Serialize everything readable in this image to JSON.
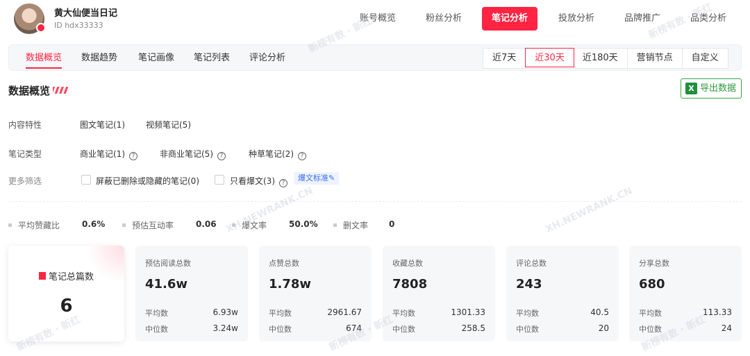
{
  "account": {
    "name": "黄大仙便当日记",
    "id_text": "ID hdx33333"
  },
  "top_nav": [
    {
      "label": "账号概览",
      "active": false
    },
    {
      "label": "粉丝分析",
      "active": false
    },
    {
      "label": "笔记分析",
      "active": true
    },
    {
      "label": "投放分析",
      "active": false
    },
    {
      "label": "品牌推广",
      "active": false
    },
    {
      "label": "品类分析",
      "active": false
    }
  ],
  "sub_tabs": [
    {
      "label": "数据概览",
      "active": true
    },
    {
      "label": "数据趋势",
      "active": false
    },
    {
      "label": "笔记画像",
      "active": false
    },
    {
      "label": "笔记列表",
      "active": false
    },
    {
      "label": "评论分析",
      "active": false
    }
  ],
  "date_ranges": [
    {
      "label": "近7天",
      "active": false
    },
    {
      "label": "近30天",
      "active": true
    },
    {
      "label": "近180天",
      "active": false
    },
    {
      "label": "营销节点",
      "active": false
    },
    {
      "label": "自定义",
      "active": false
    }
  ],
  "section": {
    "title": "数据概览",
    "export_label": "导出数据",
    "excel_glyph": "X"
  },
  "filters": {
    "content_label": "内容特性",
    "content_options": [
      "图文笔记(1)",
      "视频笔记(5)"
    ],
    "type_label": "笔记类型",
    "type_options": [
      "商业笔记(1)",
      "非商业笔记(5)",
      "种草笔记(2)"
    ],
    "more_label": "更多筛选",
    "hide_deleted_label": "屏蔽已删除或隐藏的笔记(0)",
    "only_viral_label": "只看爆文(3)",
    "viral_standard_tag": "爆文标准✎"
  },
  "summary_metrics": [
    {
      "label": "平均赞藏比",
      "value": "0.6%"
    },
    {
      "label": "预估互动率",
      "value": "0.06"
    },
    {
      "label": "爆文率",
      "value": "50.0%"
    },
    {
      "label": "删文率",
      "value": "0"
    }
  ],
  "total_card": {
    "label": "笔记总篇数",
    "value": "6"
  },
  "stat_cards": [
    {
      "title": "预估阅读总数",
      "value": "41.6w",
      "avg_label": "平均数",
      "avg": "6.93w",
      "median_label": "中位数",
      "median": "3.24w"
    },
    {
      "title": "点赞总数",
      "value": "1.78w",
      "avg_label": "平均数",
      "avg": "2961.67",
      "median_label": "中位数",
      "median": "674"
    },
    {
      "title": "收藏总数",
      "value": "7808",
      "avg_label": "平均数",
      "avg": "1301.33",
      "median_label": "中位数",
      "median": "258.5"
    },
    {
      "title": "评论总数",
      "value": "243",
      "avg_label": "平均数",
      "avg": "40.5",
      "median_label": "中位数",
      "median": "20"
    },
    {
      "title": "分享总数",
      "value": "680",
      "avg_label": "平均数",
      "avg": "113.33",
      "median_label": "中位数",
      "median": "24"
    }
  ],
  "watermarks": {
    "cn": "新榜有数 · 新红",
    "en": "XH.NEWRANK.CN"
  },
  "colors": {
    "accent": "#ff2442",
    "export_green": "#2f9a40",
    "link_blue": "#3a6ef0"
  },
  "help_glyph": "?"
}
